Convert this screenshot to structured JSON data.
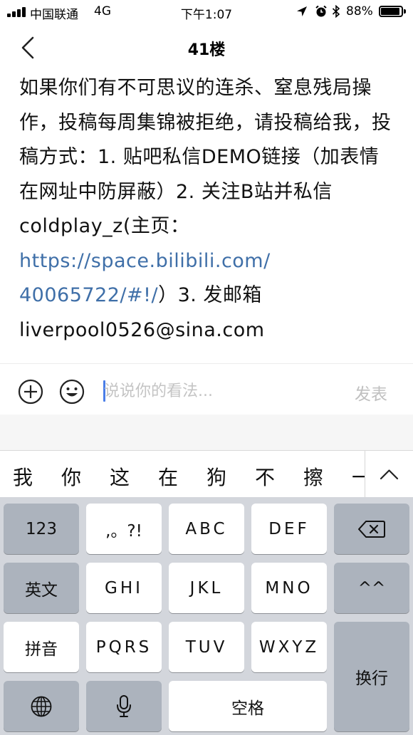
{
  "status_bar": {
    "carrier": "中国联通",
    "network": "4G",
    "time": "下午1:07",
    "battery_percent": "88%",
    "icons": [
      "signal-icon",
      "location-icon",
      "alarm-icon",
      "bluetooth-icon",
      "battery-icon"
    ]
  },
  "nav": {
    "title": "41楼",
    "back_icon": "chevron-left-icon"
  },
  "post": {
    "text_before_link": "如果你们有不可思议的连杀、窒息残局操作，投稿每周集锦被拒绝，请投稿给我，投稿方式：1. 贴吧私信DEMO链接（加表情在网址中防屏蔽）2. 关注B站并私信 coldplay_z(主页：",
    "link_line1": "https://space.bilibili.com/",
    "link_line2": "40065722/#!/",
    "text_after_link": "）3. 发邮箱",
    "email": "liverpool0526@sina.com"
  },
  "comment_bar": {
    "placeholder": "说说你的看法...",
    "value": "",
    "send_label": "发表",
    "icons": [
      "plus-circle-icon",
      "emoji-icon"
    ]
  },
  "candidates": {
    "items": [
      "我",
      "你",
      "这",
      "在",
      "狗",
      "不",
      "擦",
      "一"
    ],
    "expand_icon": "chevron-up-icon"
  },
  "keyboard": {
    "row1": {
      "mode": "123",
      "keys": [
        ",。?!",
        "ABC",
        "DEF"
      ],
      "delete_icon": "backspace-icon"
    },
    "row2": {
      "mode": "英文",
      "keys": [
        "GHI",
        "JKL",
        "MNO"
      ],
      "extra": "^^"
    },
    "row3": {
      "mode": "拼音",
      "keys": [
        "PQRS",
        "TUV",
        "WXYZ"
      ],
      "enter": "换行"
    },
    "row4": {
      "globe_icon": "globe-icon",
      "mic_icon": "microphone-icon",
      "space": "空格"
    }
  },
  "colors": {
    "link": "#3f6fa8",
    "caret": "#4a7ee8",
    "placeholder": "#c4c4c4",
    "keyboard_bg": "#d3d6dc",
    "key_light": "#ffffff",
    "key_dark": "#acb3bd"
  }
}
